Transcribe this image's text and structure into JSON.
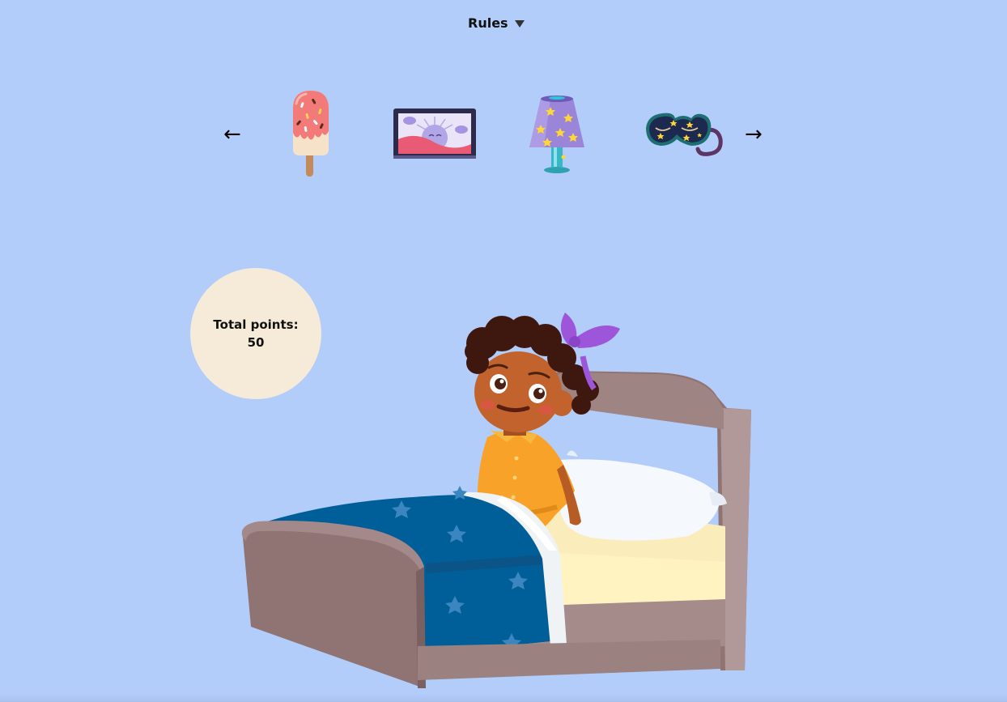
{
  "header": {
    "rules_label": "Rules"
  },
  "carousel": {
    "prev_arrow": "←",
    "next_arrow": "→",
    "items": [
      {
        "icon": "popsicle-icon"
      },
      {
        "icon": "sunrise-picture-icon"
      },
      {
        "icon": "starry-lamp-icon"
      },
      {
        "icon": "sleep-mask-icon"
      }
    ]
  },
  "score": {
    "label": "Total points:",
    "value": "50"
  },
  "scene": {
    "icon": "girl-in-bed"
  },
  "colors": {
    "background": "#b3cdfb",
    "points_circle": "#f6ebd8",
    "blanket": "#005f98",
    "bed_frame": "#8f7473"
  }
}
